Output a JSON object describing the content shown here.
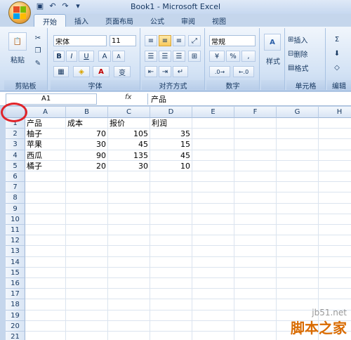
{
  "window": {
    "title": "Book1 - Microsoft Excel"
  },
  "quick_access": {
    "items": [
      "save-icon",
      "undo-icon",
      "redo-icon",
      "customize-icon"
    ]
  },
  "tabs": [
    "开始",
    "插入",
    "页面布局",
    "公式",
    "审阅",
    "视图"
  ],
  "ribbon": {
    "clipboard": {
      "paste": "粘贴",
      "label": "剪贴板"
    },
    "font": {
      "name": "宋体",
      "size": "11",
      "bold": "B",
      "italic": "I",
      "underline": "U",
      "grow": "A",
      "shrink": "A",
      "font_color": "A",
      "phonetic": "变",
      "label": "字体"
    },
    "alignment": {
      "label": "对齐方式"
    },
    "number": {
      "format": "常规",
      "percent": "%",
      "comma": ",",
      "label": "数字"
    },
    "styles": {
      "label": "样式"
    },
    "cells": {
      "insert": "插入",
      "delete": "删除",
      "format": "格式",
      "label": "单元格"
    },
    "editing": {
      "label": "编辑"
    }
  },
  "formula_bar": {
    "name_box": "A1",
    "fx": "fx",
    "content": "产品"
  },
  "columns": [
    "A",
    "B",
    "C",
    "D",
    "E",
    "F",
    "G",
    "H"
  ],
  "rows": [
    "1",
    "2",
    "3",
    "4",
    "5",
    "6",
    "7",
    "8",
    "9",
    "10",
    "11",
    "12",
    "13",
    "14",
    "15",
    "16",
    "17",
    "18",
    "19",
    "20",
    "21"
  ],
  "table": {
    "header": [
      "产品",
      "成本",
      "报价",
      "利润"
    ],
    "rows": [
      [
        "柚子",
        "70",
        "105",
        "35"
      ],
      [
        "苹果",
        "30",
        "45",
        "15"
      ],
      [
        "西瓜",
        "90",
        "135",
        "45"
      ],
      [
        "橘子",
        "20",
        "30",
        "10"
      ]
    ]
  },
  "watermark": {
    "url": "jb51.net",
    "text": "脚本之家"
  }
}
